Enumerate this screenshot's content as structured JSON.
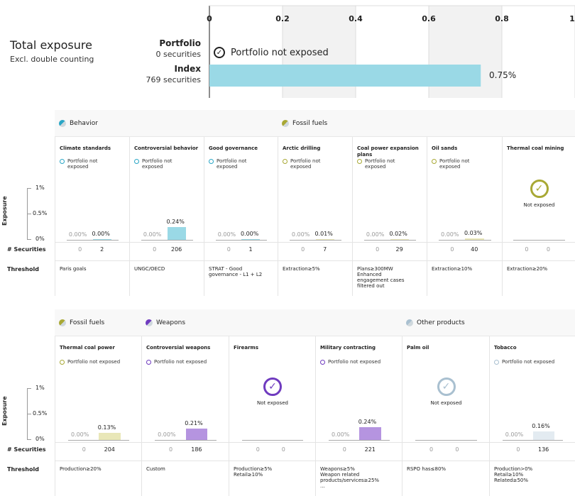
{
  "top": {
    "title": "Total exposure",
    "subtitle": "Excl. double counting",
    "portfolio_label": "Portfolio",
    "portfolio_count": "0 securities",
    "portfolio_note": "Portfolio not exposed",
    "index_label": "Index",
    "index_count": "769 securities",
    "index_value_label": "0.75%",
    "axis_ticks": [
      "0",
      "0.2",
      "0.4",
      "0.6",
      "0.8",
      "1"
    ]
  },
  "labels": {
    "securities": "# Securities",
    "threshold": "Threshold",
    "exposure": "Exposure",
    "not_exposed": "Not exposed",
    "y_ticks": [
      "1%",
      "0.5%",
      "0%"
    ]
  },
  "colors": {
    "behavior": "#2aa6c6",
    "fossil": "#a8a835",
    "weapons": "#6f3bbf",
    "other": "#a9c0d0",
    "index_bar": "#9ad9e6",
    "fossil_bar": "#e9e7b8",
    "weapons_bar": "#b594e0",
    "other_bar": "#e3ebf1"
  },
  "chart_data": [
    {
      "type": "bar",
      "title": "Total exposure",
      "categories": [
        "Portfolio",
        "Index"
      ],
      "values": [
        0,
        0.75
      ],
      "xlim": [
        0,
        1
      ],
      "x_ticks": [
        0,
        0.2,
        0.4,
        0.6,
        0.8,
        1
      ],
      "grid": true
    },
    {
      "type": "bar",
      "ylabel": "Exposure",
      "ylim": [
        0,
        1
      ],
      "groups": [
        {
          "name": "Behavior",
          "items": [
            {
              "name": "Climate standards",
              "portfolio": 0,
              "index": 0,
              "portfolio_count": 0,
              "index_count": 2,
              "threshold": "Paris goals",
              "note": "Portfolio not exposed"
            },
            {
              "name": "Controversial behavior",
              "portfolio": 0,
              "index": 0.24,
              "portfolio_count": 0,
              "index_count": 206,
              "threshold": "UNGC/OECD",
              "note": "Portfolio not exposed"
            },
            {
              "name": "Good governance",
              "portfolio": 0,
              "index": 0,
              "portfolio_count": 0,
              "index_count": 1,
              "threshold": "STRAT - Good governance - L1 + L2",
              "note": "Portfolio not exposed"
            }
          ]
        },
        {
          "name": "Fossil fuels",
          "items": [
            {
              "name": "Arctic drilling",
              "portfolio": 0,
              "index": 0.01,
              "portfolio_count": 0,
              "index_count": 7,
              "threshold": "Extraction≥5%",
              "note": "Portfolio not exposed"
            },
            {
              "name": "Coal power expansion plans",
              "portfolio": 0,
              "index": 0.02,
              "portfolio_count": 0,
              "index_count": 29,
              "threshold": "Plans≥300MW Enhanced engagement cases filtered out",
              "note": "Portfolio not exposed"
            },
            {
              "name": "Oil sands",
              "portfolio": 0,
              "index": 0.03,
              "portfolio_count": 0,
              "index_count": 40,
              "threshold": "Extraction≥10%",
              "note": "Portfolio not exposed"
            },
            {
              "name": "Thermal coal mining",
              "portfolio": null,
              "index": null,
              "portfolio_count": 0,
              "index_count": 0,
              "threshold": "Extraction≥20%",
              "note": "Not exposed"
            }
          ]
        }
      ]
    },
    {
      "type": "bar",
      "ylabel": "Exposure",
      "ylim": [
        0,
        1
      ],
      "groups": [
        {
          "name": "Fossil fuels",
          "items": [
            {
              "name": "Thermal coal power",
              "portfolio": 0,
              "index": 0.13,
              "portfolio_count": 0,
              "index_count": 204,
              "threshold": "Production≥20%",
              "note": "Portfolio not exposed"
            }
          ]
        },
        {
          "name": "Weapons",
          "items": [
            {
              "name": "Controversial weapons",
              "portfolio": 0,
              "index": 0.21,
              "portfolio_count": 0,
              "index_count": 186,
              "threshold": "Custom",
              "note": "Portfolio not exposed"
            },
            {
              "name": "Firearms",
              "portfolio": null,
              "index": null,
              "portfolio_count": 0,
              "index_count": 0,
              "threshold": "Production≥5% Retail≥10%",
              "note": "Not exposed"
            },
            {
              "name": "Military contracting",
              "portfolio": 0,
              "index": 0.24,
              "portfolio_count": 0,
              "index_count": 221,
              "threshold": "Weapons≥5% Weapon related products/services≥25% ...",
              "note": "Portfolio not exposed"
            }
          ]
        },
        {
          "name": "Other products",
          "items": [
            {
              "name": "Palm oil",
              "portfolio": null,
              "index": null,
              "portfolio_count": 0,
              "index_count": 0,
              "threshold": "RSPO has≤80%",
              "note": "Not exposed"
            },
            {
              "name": "Tobacco",
              "portfolio": 0,
              "index": 0.16,
              "portfolio_count": 0,
              "index_count": 136,
              "threshold": "Production>0% Retail≥10% Related≥50%",
              "note": "Portfolio not exposed"
            }
          ]
        }
      ]
    }
  ],
  "panel1": {
    "cats": [
      {
        "label": "Behavior"
      },
      {
        "label": "Fossil fuels"
      }
    ],
    "cols": [
      {
        "name": "Climate standards",
        "note": "Portfolio not",
        "note2": "exposed",
        "p": "0.00%",
        "i": "0.00%",
        "pc": "0",
        "ic": "2",
        "thr1": "Paris goals",
        "thr2": "",
        "thr3": "",
        "thr4": ""
      },
      {
        "name": "Controversial behavior",
        "note": "Portfolio not",
        "note2": "exposed",
        "p": "0.00%",
        "i": "0.24%",
        "pc": "0",
        "ic": "206",
        "thr1": "UNGC/OECD",
        "thr2": "",
        "thr3": "",
        "thr4": ""
      },
      {
        "name": "Good governance",
        "note": "Portfolio not",
        "note2": "exposed",
        "p": "0.00%",
        "i": "0.00%",
        "pc": "0",
        "ic": "1",
        "thr1": "STRAT - Good",
        "thr2": "governance - L1 + L2",
        "thr3": "",
        "thr4": ""
      },
      {
        "name": "Arctic drilling",
        "note": "Portfolio not",
        "note2": "exposed",
        "p": "0.00%",
        "i": "0.01%",
        "pc": "0",
        "ic": "7",
        "thr1": "Extraction≥5%",
        "thr2": "",
        "thr3": "",
        "thr4": ""
      },
      {
        "name": "Coal power expansion",
        "name2": "plans",
        "note": "Portfolio not",
        "note2": "exposed",
        "p": "0.00%",
        "i": "0.02%",
        "pc": "0",
        "ic": "29",
        "thr1": "Plans≥300MW",
        "thr2": "Enhanced",
        "thr3": "engagement cases",
        "thr4": "filtered out"
      },
      {
        "name": "Oil sands",
        "note": "Portfolio not",
        "note2": "exposed",
        "p": "0.00%",
        "i": "0.03%",
        "pc": "0",
        "ic": "40",
        "thr1": "Extraction≥10%",
        "thr2": "",
        "thr3": "",
        "thr4": ""
      },
      {
        "name": "Thermal coal mining",
        "note": "",
        "note2": "",
        "p": "",
        "i": "",
        "pc": "0",
        "ic": "0",
        "thr1": "Extraction≥20%",
        "thr2": "",
        "thr3": "",
        "thr4": ""
      }
    ]
  },
  "panel2": {
    "cats": [
      {
        "label": "Fossil fuels"
      },
      {
        "label": "Weapons"
      },
      {
        "label": "Other products"
      }
    ],
    "cols": [
      {
        "name": "Thermal coal power",
        "note": "Portfolio not exposed",
        "p": "0.00%",
        "i": "0.13%",
        "pc": "0",
        "ic": "204",
        "thr1": "Production≥20%",
        "thr2": "",
        "thr3": "",
        "thr4": ""
      },
      {
        "name": "Controversial weapons",
        "note": "Portfolio not exposed",
        "p": "0.00%",
        "i": "0.21%",
        "pc": "0",
        "ic": "186",
        "thr1": "Custom",
        "thr2": "",
        "thr3": "",
        "thr4": ""
      },
      {
        "name": "Firearms",
        "note": "",
        "p": "",
        "i": "",
        "pc": "0",
        "ic": "0",
        "thr1": "Production≥5%",
        "thr2": "Retail≥10%",
        "thr3": "",
        "thr4": ""
      },
      {
        "name": "Military contracting",
        "note": "Portfolio not exposed",
        "p": "0.00%",
        "i": "0.24%",
        "pc": "0",
        "ic": "221",
        "thr1": "Weapons≥5%",
        "thr2": "Weapon related",
        "thr3": "products/services≥25%",
        "thr4": "..."
      },
      {
        "name": "Palm oil",
        "note": "",
        "p": "",
        "i": "",
        "pc": "0",
        "ic": "0",
        "thr1": "RSPO has≤80%",
        "thr2": "",
        "thr3": "",
        "thr4": ""
      },
      {
        "name": "Tobacco",
        "note": "Portfolio not exposed",
        "p": "0.00%",
        "i": "0.16%",
        "pc": "0",
        "ic": "136",
        "thr1": "Production>0%",
        "thr2": "Retail≥10%",
        "thr3": "Related≥50%",
        "thr4": ""
      }
    ]
  }
}
